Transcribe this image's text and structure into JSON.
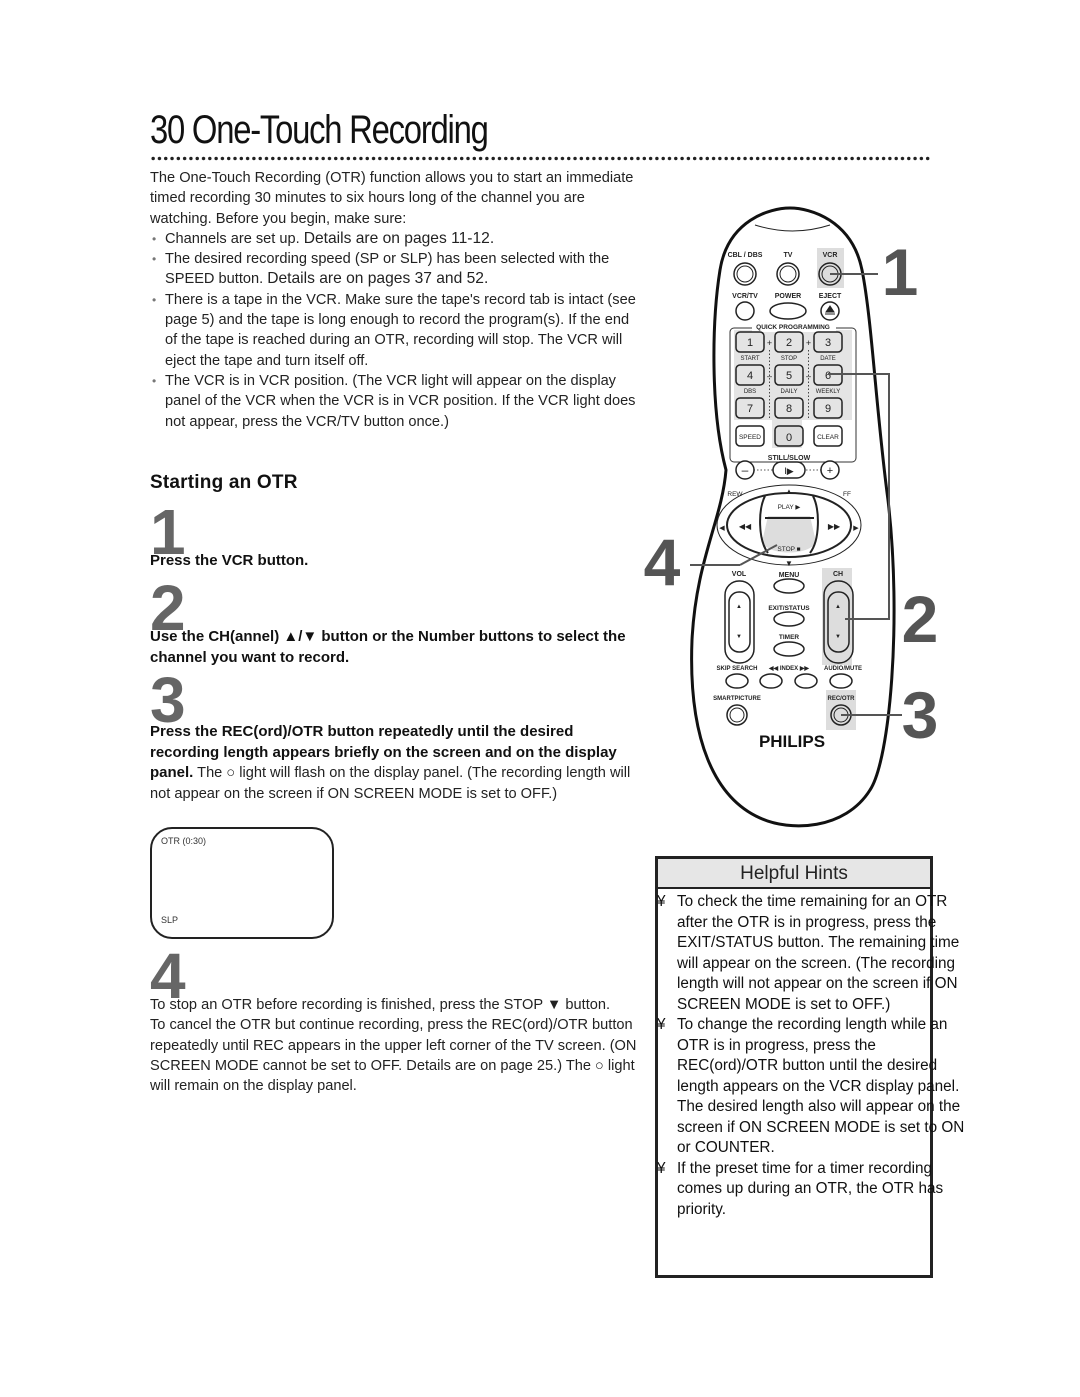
{
  "page": {
    "title": "30  One-Touch Recording"
  },
  "intro": {
    "paragraph": "The One-Touch Recording (OTR) function allows you to start an immediate timed recording 30 minutes to six hours long of the channel you are watching. Before you begin, make sure:",
    "bullets": [
      {
        "text": "Channels are set up. ",
        "ref": "Details are on pages 11-12."
      },
      {
        "text": "The desired recording speed (SP or SLP) has been selected with the SPEED button. ",
        "ref": "Details are on pages 37 and 52."
      },
      {
        "text": "There is a tape in the VCR. Make sure the tape's record tab is intact (see page 5) and the tape is long enough to record the program(s). If the end of the tape is reached during an OTR, recording will stop. The VCR will eject the tape and turn itself off.",
        "ref": ""
      },
      {
        "text": "The VCR is in VCR position. (The VCR light will appear on the display panel of the VCR when the VCR is in VCR position. If the VCR light does not appear, press the VCR/TV button once.)",
        "ref": ""
      }
    ]
  },
  "section": {
    "heading": "Starting an OTR",
    "steps": [
      {
        "number": "1",
        "bold": "Press the VCR button.",
        "normal": ""
      },
      {
        "number": "2",
        "bold": "Use the CH(annel) ▲/▼ button or the Number buttons to select the channel you want to record.",
        "normal": ""
      },
      {
        "number": "3",
        "bold": "Press the REC(ord)/OTR button repeatedly until the desired recording length appears briefly on the screen and on the display panel.",
        "normal": " The ○ light will flash on the display panel. (The recording length will not appear on the screen if ON SCREEN MODE is set to OFF.)"
      },
      {
        "number": "4",
        "bold": "",
        "normal": "To stop an OTR before recording is finished, press the STOP ▼ button.\nTo cancel the OTR but continue recording, press the REC(ord)/OTR button repeatedly until REC appears in the upper left corner of the TV screen. (ON SCREEN MODE cannot be set to OFF. Details are on page 25.) The ○ light will remain on the display panel."
      }
    ]
  },
  "tv_screen": {
    "top_left": "OTR (0:30)",
    "bottom_left": "SLP"
  },
  "hints": {
    "title": "Helpful Hints",
    "bullet_glyph": "¥",
    "items": [
      "To check the time remaining for an OTR after the OTR is in progress, press the EXIT/STATUS button. The remaining time will appear on the screen. (The recording length will not appear on the screen if ON SCREEN MODE is set to OFF.)",
      "To change the recording length while an OTR is in progress, press the REC(ord)/OTR button until the desired length appears on the VCR display panel.  The desired length also will appear on the screen if ON SCREEN MODE is set to ON or COUNTER.",
      "If the preset time for a timer recording comes up during an OTR, the OTR has priority."
    ]
  },
  "remote": {
    "brand": "PHILIPS",
    "callouts": [
      "1",
      "2",
      "3",
      "4"
    ],
    "labels": {
      "cbl_dbs": "CBL / DBS",
      "tv": "TV",
      "vcr": "VCR",
      "vcr_tv": "VCR/TV",
      "power": "POWER",
      "eject": "EJECT",
      "quick_programming": "QUICK PROGRAMMING",
      "start": "START",
      "stop": "STOP",
      "date": "DATE",
      "dbs": "DBS",
      "daily": "DAILY",
      "weekly": "WEEKLY",
      "speed": "SPEED",
      "clear": "CLEAR",
      "still_slow": "STILL/SLOW",
      "rew": "REW",
      "ff": "FF",
      "play": "PLAY ▶",
      "stop_btn": "STOP ■",
      "vol": "VOL",
      "menu": "MENU",
      "ch": "CH",
      "exit_status": "EXIT/STATUS",
      "timer": "TIMER",
      "skip_search": "SKIP SEARCH",
      "index": "◀◀ INDEX ▶▶",
      "audio_mute": "AUDIO/MUTE",
      "smartpicture": "SMARTPICTURE",
      "rec_otr": "REC/OTR"
    },
    "digits": [
      "1",
      "2",
      "3",
      "4",
      "5",
      "6",
      "7",
      "8",
      "9",
      "0"
    ]
  }
}
